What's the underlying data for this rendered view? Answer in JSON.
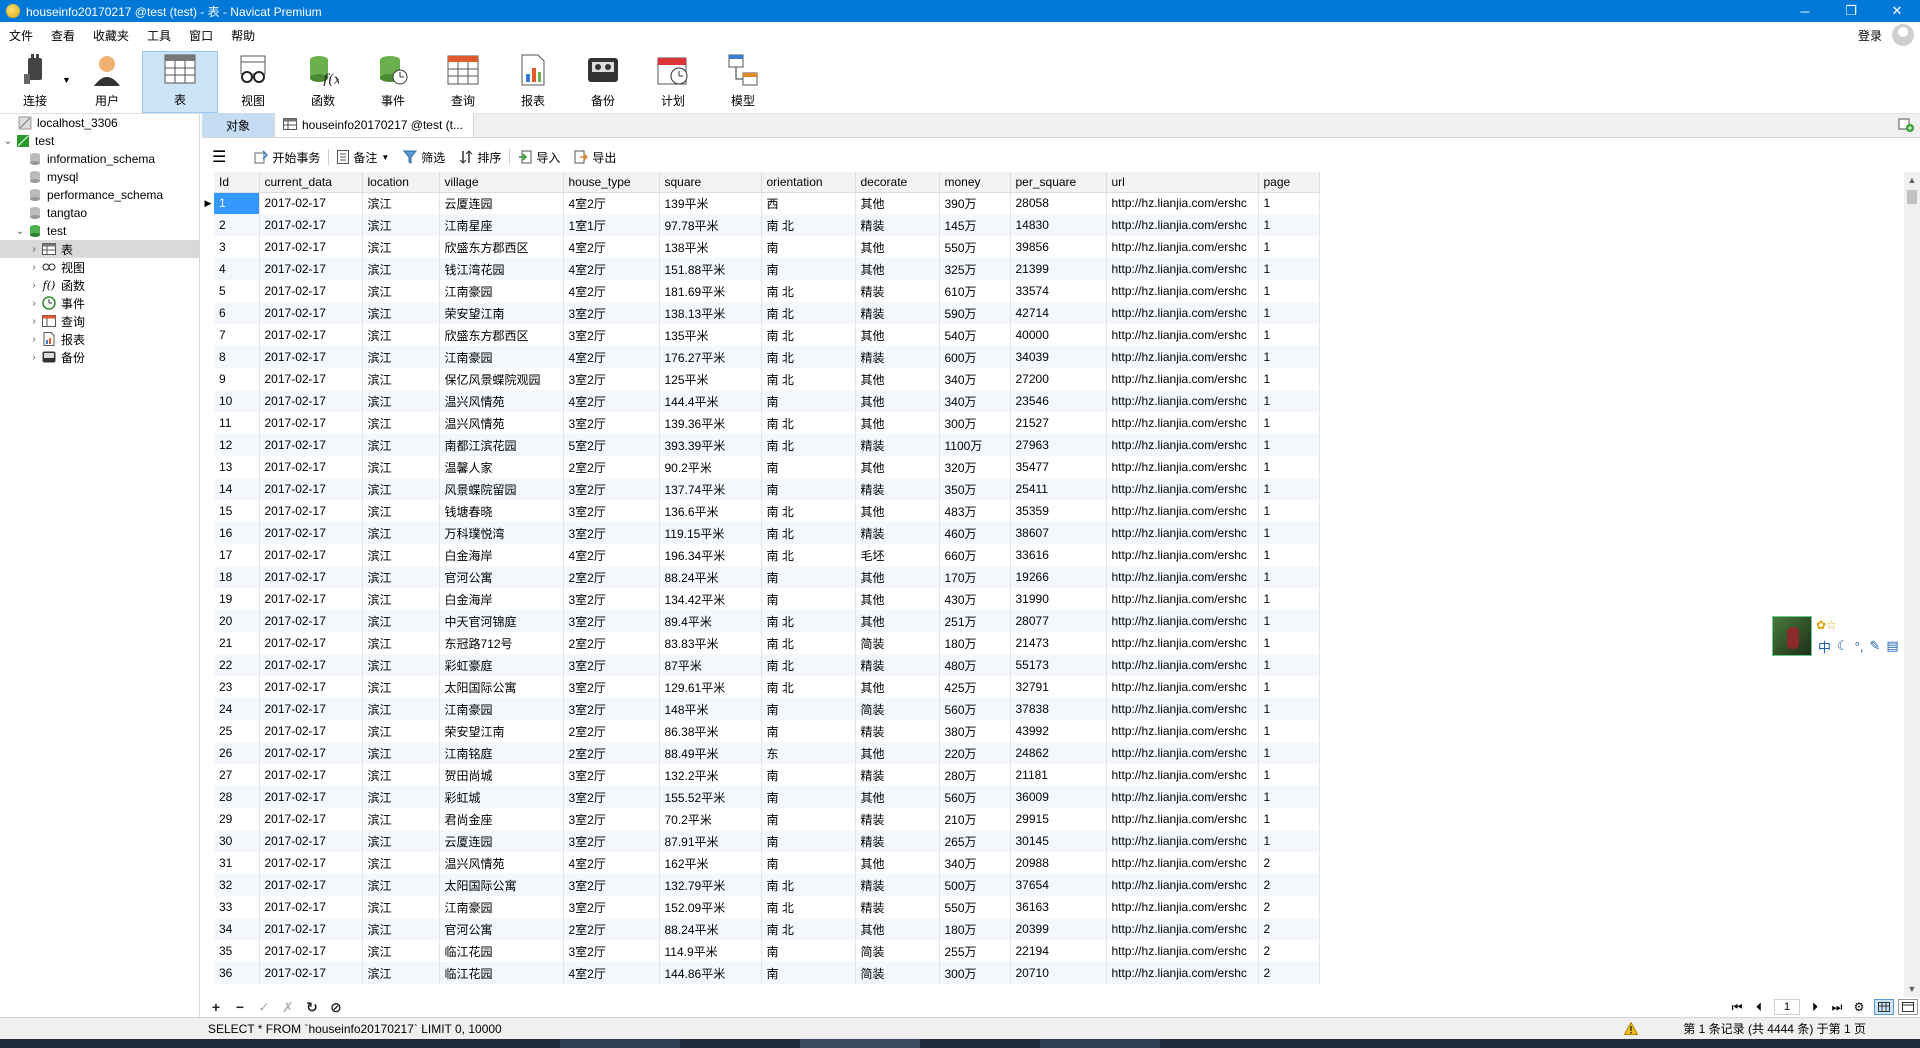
{
  "window": {
    "title": "houseinfo20170217 @test (test) - 表 - Navicat Premium",
    "minimize": "─",
    "maximize": "❐",
    "close": "✕"
  },
  "menu": [
    "文件",
    "查看",
    "收藏夹",
    "工具",
    "窗口",
    "帮助"
  ],
  "login_label": "登录",
  "toolbar": {
    "connect": "连接",
    "user": "用户",
    "table": "表",
    "view": "视图",
    "function": "函数",
    "event": "事件",
    "query": "查询",
    "report": "报表",
    "backup": "备份",
    "schedule": "计划",
    "model": "模型"
  },
  "navigator": {
    "connection": "localhost_3306",
    "db_test_conn": "test",
    "databases": [
      "information_schema",
      "mysql",
      "performance_schema",
      "tangtao"
    ],
    "db_test": "test",
    "children": [
      "表",
      "视图",
      "函数",
      "事件",
      "查询",
      "报表",
      "备份"
    ]
  },
  "tabs": {
    "objects": "对象",
    "table_tab": "houseinfo20170217 @test (t..."
  },
  "table_tools": {
    "begin_transaction": "开始事务",
    "memo": "备注",
    "filter": "筛选",
    "sort": "排序",
    "import": "导入",
    "export": "导出"
  },
  "grid": {
    "columns": [
      "Id",
      "current_data",
      "location",
      "village",
      "house_type",
      "square",
      "orientation",
      "decorate",
      "money",
      "per_square",
      "url",
      "page"
    ],
    "rows": [
      [
        "1",
        "2017-02-17",
        "滨江",
        "云厦连园",
        "4室2厅",
        "139平米",
        "西",
        "其他",
        "390万",
        "28058",
        "http://hz.lianjia.com/ershc",
        "1"
      ],
      [
        "2",
        "2017-02-17",
        "滨江",
        "江南星座",
        "1室1厅",
        "97.78平米",
        "南 北",
        "精装",
        "145万",
        "14830",
        "http://hz.lianjia.com/ershc",
        "1"
      ],
      [
        "3",
        "2017-02-17",
        "滨江",
        "欣盛东方郡西区",
        "4室2厅",
        "138平米",
        "南",
        "其他",
        "550万",
        "39856",
        "http://hz.lianjia.com/ershc",
        "1"
      ],
      [
        "4",
        "2017-02-17",
        "滨江",
        "钱江湾花园",
        "4室2厅",
        "151.88平米",
        "南",
        "其他",
        "325万",
        "21399",
        "http://hz.lianjia.com/ershc",
        "1"
      ],
      [
        "5",
        "2017-02-17",
        "滨江",
        "江南豪园",
        "4室2厅",
        "181.69平米",
        "南 北",
        "精装",
        "610万",
        "33574",
        "http://hz.lianjia.com/ershc",
        "1"
      ],
      [
        "6",
        "2017-02-17",
        "滨江",
        "荣安望江南",
        "3室2厅",
        "138.13平米",
        "南 北",
        "精装",
        "590万",
        "42714",
        "http://hz.lianjia.com/ershc",
        "1"
      ],
      [
        "7",
        "2017-02-17",
        "滨江",
        "欣盛东方郡西区",
        "3室2厅",
        "135平米",
        "南 北",
        "其他",
        "540万",
        "40000",
        "http://hz.lianjia.com/ershc",
        "1"
      ],
      [
        "8",
        "2017-02-17",
        "滨江",
        "江南豪园",
        "4室2厅",
        "176.27平米",
        "南 北",
        "精装",
        "600万",
        "34039",
        "http://hz.lianjia.com/ershc",
        "1"
      ],
      [
        "9",
        "2017-02-17",
        "滨江",
        "保亿风景蝶院观园",
        "3室2厅",
        "125平米",
        "南 北",
        "其他",
        "340万",
        "27200",
        "http://hz.lianjia.com/ershc",
        "1"
      ],
      [
        "10",
        "2017-02-17",
        "滨江",
        "温兴风情苑",
        "4室2厅",
        "144.4平米",
        "南",
        "其他",
        "340万",
        "23546",
        "http://hz.lianjia.com/ershc",
        "1"
      ],
      [
        "11",
        "2017-02-17",
        "滨江",
        "温兴风情苑",
        "3室2厅",
        "139.36平米",
        "南 北",
        "其他",
        "300万",
        "21527",
        "http://hz.lianjia.com/ershc",
        "1"
      ],
      [
        "12",
        "2017-02-17",
        "滨江",
        "南都江滨花园",
        "5室2厅",
        "393.39平米",
        "南 北",
        "精装",
        "1100万",
        "27963",
        "http://hz.lianjia.com/ershc",
        "1"
      ],
      [
        "13",
        "2017-02-17",
        "滨江",
        "温馨人家",
        "2室2厅",
        "90.2平米",
        "南",
        "其他",
        "320万",
        "35477",
        "http://hz.lianjia.com/ershc",
        "1"
      ],
      [
        "14",
        "2017-02-17",
        "滨江",
        "风景蝶院留园",
        "3室2厅",
        "137.74平米",
        "南",
        "精装",
        "350万",
        "25411",
        "http://hz.lianjia.com/ershc",
        "1"
      ],
      [
        "15",
        "2017-02-17",
        "滨江",
        "钱塘春晓",
        "3室2厅",
        "136.6平米",
        "南 北",
        "其他",
        "483万",
        "35359",
        "http://hz.lianjia.com/ershc",
        "1"
      ],
      [
        "16",
        "2017-02-17",
        "滨江",
        "万科璞悦湾",
        "3室2厅",
        "119.15平米",
        "南 北",
        "精装",
        "460万",
        "38607",
        "http://hz.lianjia.com/ershc",
        "1"
      ],
      [
        "17",
        "2017-02-17",
        "滨江",
        "白金海岸",
        "4室2厅",
        "196.34平米",
        "南 北",
        "毛坯",
        "660万",
        "33616",
        "http://hz.lianjia.com/ershc",
        "1"
      ],
      [
        "18",
        "2017-02-17",
        "滨江",
        "官河公寓",
        "2室2厅",
        "88.24平米",
        "南",
        "其他",
        "170万",
        "19266",
        "http://hz.lianjia.com/ershc",
        "1"
      ],
      [
        "19",
        "2017-02-17",
        "滨江",
        "白金海岸",
        "3室2厅",
        "134.42平米",
        "南",
        "其他",
        "430万",
        "31990",
        "http://hz.lianjia.com/ershc",
        "1"
      ],
      [
        "20",
        "2017-02-17",
        "滨江",
        "中天官河锦庭",
        "3室2厅",
        "89.4平米",
        "南 北",
        "其他",
        "251万",
        "28077",
        "http://hz.lianjia.com/ershc",
        "1"
      ],
      [
        "21",
        "2017-02-17",
        "滨江",
        "东冠路712号",
        "2室2厅",
        "83.83平米",
        "南 北",
        "简装",
        "180万",
        "21473",
        "http://hz.lianjia.com/ershc",
        "1"
      ],
      [
        "22",
        "2017-02-17",
        "滨江",
        "彩虹豪庭",
        "3室2厅",
        "87平米",
        "南 北",
        "精装",
        "480万",
        "55173",
        "http://hz.lianjia.com/ershc",
        "1"
      ],
      [
        "23",
        "2017-02-17",
        "滨江",
        "太阳国际公寓",
        "3室2厅",
        "129.61平米",
        "南 北",
        "其他",
        "425万",
        "32791",
        "http://hz.lianjia.com/ershc",
        "1"
      ],
      [
        "24",
        "2017-02-17",
        "滨江",
        "江南豪园",
        "3室2厅",
        "148平米",
        "南",
        "简装",
        "560万",
        "37838",
        "http://hz.lianjia.com/ershc",
        "1"
      ],
      [
        "25",
        "2017-02-17",
        "滨江",
        "荣安望江南",
        "2室2厅",
        "86.38平米",
        "南",
        "精装",
        "380万",
        "43992",
        "http://hz.lianjia.com/ershc",
        "1"
      ],
      [
        "26",
        "2017-02-17",
        "滨江",
        "江南铭庭",
        "2室2厅",
        "88.49平米",
        "东",
        "其他",
        "220万",
        "24862",
        "http://hz.lianjia.com/ershc",
        "1"
      ],
      [
        "27",
        "2017-02-17",
        "滨江",
        "贺田尚城",
        "3室2厅",
        "132.2平米",
        "南",
        "精装",
        "280万",
        "21181",
        "http://hz.lianjia.com/ershc",
        "1"
      ],
      [
        "28",
        "2017-02-17",
        "滨江",
        "彩虹城",
        "3室2厅",
        "155.52平米",
        "南",
        "其他",
        "560万",
        "36009",
        "http://hz.lianjia.com/ershc",
        "1"
      ],
      [
        "29",
        "2017-02-17",
        "滨江",
        "君尚金座",
        "3室2厅",
        "70.2平米",
        "南",
        "精装",
        "210万",
        "29915",
        "http://hz.lianjia.com/ershc",
        "1"
      ],
      [
        "30",
        "2017-02-17",
        "滨江",
        "云厦连园",
        "3室2厅",
        "87.91平米",
        "南",
        "精装",
        "265万",
        "30145",
        "http://hz.lianjia.com/ershc",
        "1"
      ],
      [
        "31",
        "2017-02-17",
        "滨江",
        "温兴风情苑",
        "4室2厅",
        "162平米",
        "南",
        "其他",
        "340万",
        "20988",
        "http://hz.lianjia.com/ershc",
        "2"
      ],
      [
        "32",
        "2017-02-17",
        "滨江",
        "太阳国际公寓",
        "3室2厅",
        "132.79平米",
        "南 北",
        "精装",
        "500万",
        "37654",
        "http://hz.lianjia.com/ershc",
        "2"
      ],
      [
        "33",
        "2017-02-17",
        "滨江",
        "江南豪园",
        "3室2厅",
        "152.09平米",
        "南 北",
        "精装",
        "550万",
        "36163",
        "http://hz.lianjia.com/ershc",
        "2"
      ],
      [
        "34",
        "2017-02-17",
        "滨江",
        "官河公寓",
        "2室2厅",
        "88.24平米",
        "南 北",
        "其他",
        "180万",
        "20399",
        "http://hz.lianjia.com/ershc",
        "2"
      ],
      [
        "35",
        "2017-02-17",
        "滨江",
        "临江花园",
        "3室2厅",
        "114.9平米",
        "南",
        "简装",
        "255万",
        "22194",
        "http://hz.lianjia.com/ershc",
        "2"
      ],
      [
        "36",
        "2017-02-17",
        "滨江",
        "临江花园",
        "4室2厅",
        "144.86平米",
        "南",
        "简装",
        "300万",
        "20710",
        "http://hz.lianjia.com/ershc",
        "2"
      ]
    ]
  },
  "gridbar": {
    "add": "+",
    "delete": "−",
    "apply": "✓",
    "cancel": "✗",
    "refresh": "↻",
    "stop": "⊘",
    "page": "1"
  },
  "status": {
    "sql": "SELECT * FROM `houseinfo20170217` LIMIT 0, 10000",
    "records": "第 1 条记录 (共 4444 条) 于第 1 页"
  },
  "ime": {
    "top": "✿☆",
    "lang": "中"
  },
  "colors": {
    "titlebar": "#0078d7",
    "selection": "#3399ff",
    "active_tool": "#cce4f7"
  }
}
